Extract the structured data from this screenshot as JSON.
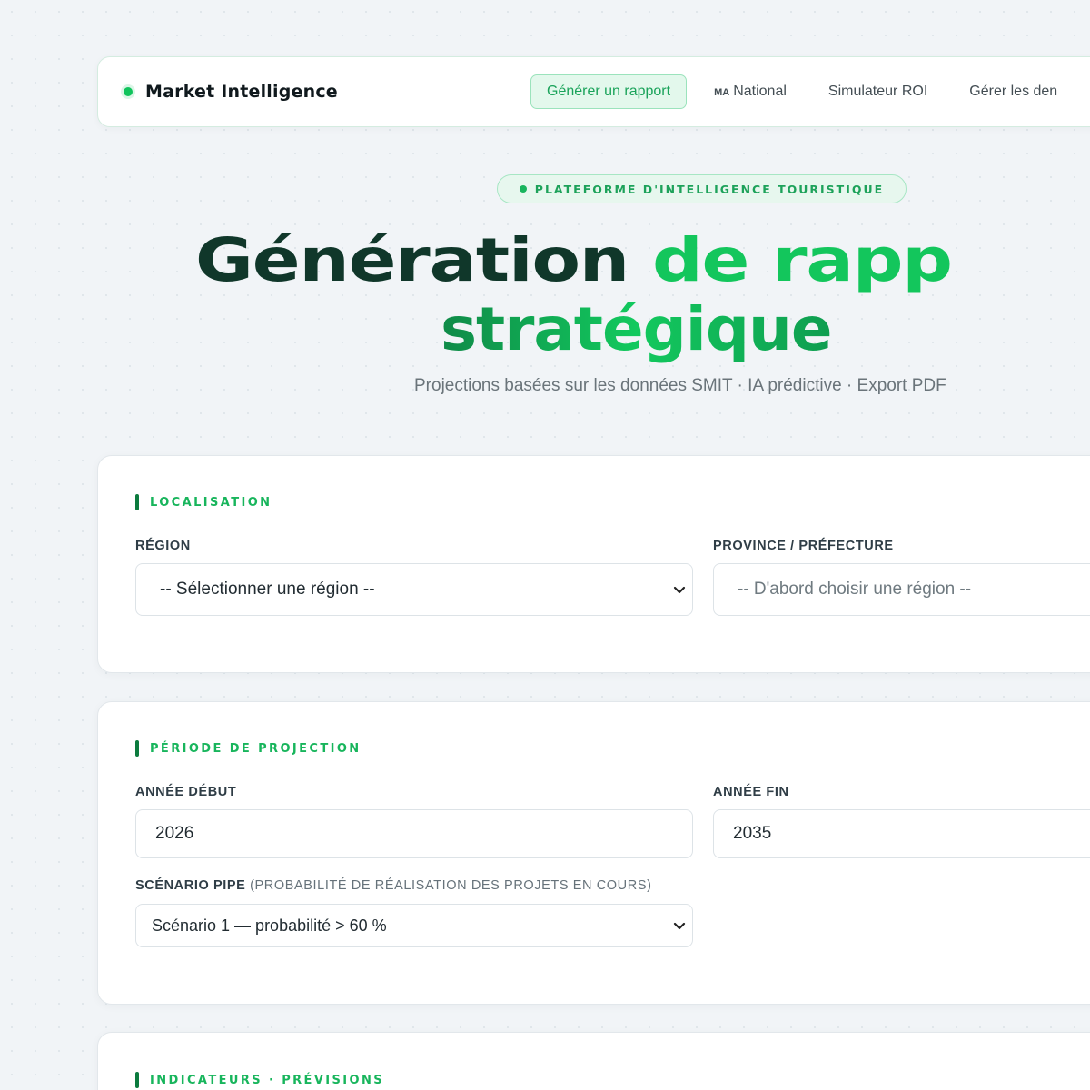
{
  "app": {
    "brand": "Market Intelligence"
  },
  "nav": {
    "items": [
      {
        "label": "Générer un rapport",
        "active": true
      },
      {
        "flag": "MA",
        "label": "National"
      },
      {
        "label": "Simulateur ROI"
      },
      {
        "label": "Gérer les den"
      }
    ]
  },
  "hero": {
    "pill": "PLATEFORME D'INTELLIGENCE TOURISTIQUE",
    "title_part1": "Génération",
    "title_part2": "de rapp",
    "title_line2": "stratégique",
    "subtitle": "Projections basées sur les données SMIT · IA prédictive · Export PDF"
  },
  "sections": {
    "localisation": {
      "title": "LOCALISATION",
      "region_label": "RÉGION",
      "region_value": "-- Sélectionner une région --",
      "province_label": "PROVINCE / PRÉFECTURE",
      "province_value": "-- D'abord choisir une région --"
    },
    "periode": {
      "title": "PÉRIODE DE PROJECTION",
      "start_label": "ANNÉE DÉBUT",
      "start_value": "2026",
      "end_label": "ANNÉE FIN",
      "end_value": "2035",
      "scenario_label": "SCÉNARIO PIPE",
      "scenario_hint": "(PROBABILITÉ DE RÉALISATION DES PROJETS EN COURS)",
      "scenario_value": "Scénario 1 — probabilité > 60 %"
    },
    "indicateurs": {
      "title": "INDICATEURS · PRÉVISIONS"
    }
  },
  "colors": {
    "accent": "#13c65c",
    "accent_dark": "#10372a",
    "section_bar": "#0c7b3e",
    "background": "#f1f4f7"
  }
}
